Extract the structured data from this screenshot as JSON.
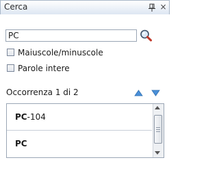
{
  "window": {
    "title": "Cerca",
    "pin_icon": "pin-icon",
    "close_glyph": "×"
  },
  "search": {
    "value": "PC",
    "button_icon": "search-icon"
  },
  "options": [
    {
      "label": "Maiuscole/minuscole",
      "checked": false
    },
    {
      "label": "Parole intere",
      "checked": false
    }
  ],
  "results": {
    "occurrence_text": "Occorrenza 1 di 2",
    "prev_icon": "arrow-up-icon",
    "next_icon": "arrow-down-icon",
    "arrow_color": "#4a90d9",
    "items": [
      {
        "match": "PC",
        "rest": "-104"
      },
      {
        "match": "PC",
        "rest": ""
      }
    ]
  }
}
